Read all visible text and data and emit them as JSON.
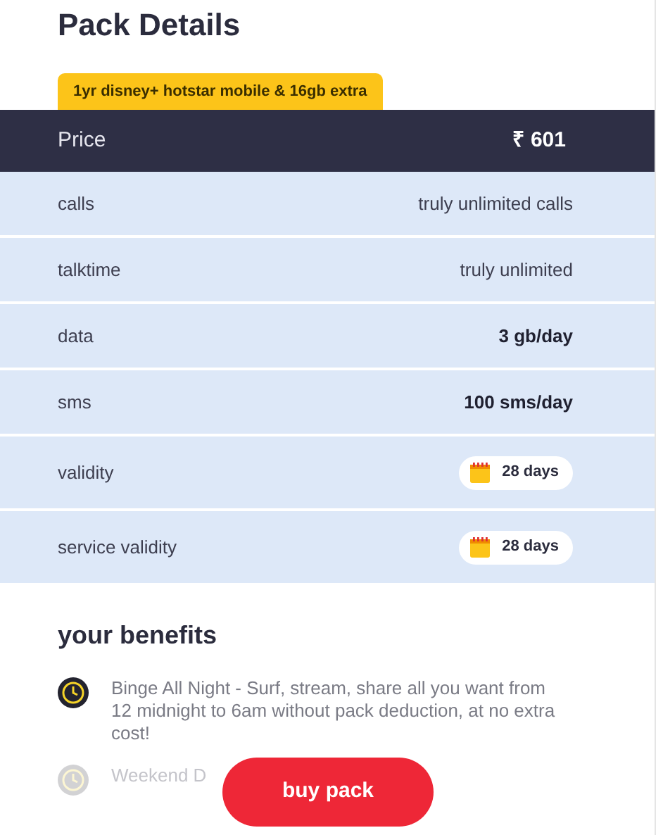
{
  "title": "Pack Details",
  "badge": "1yr disney+ hotstar mobile & 16gb extra",
  "price": {
    "label": "Price",
    "value": "₹ 601"
  },
  "rows": [
    {
      "label": "calls",
      "value": "truly unlimited calls",
      "kind": "text",
      "bold": false
    },
    {
      "label": "talktime",
      "value": "truly unlimited",
      "kind": "text",
      "bold": false
    },
    {
      "label": "data",
      "value": "3 gb/day",
      "kind": "text",
      "bold": true
    },
    {
      "label": "sms",
      "value": "100 sms/day",
      "kind": "text",
      "bold": true
    },
    {
      "label": "validity",
      "value": "28 days",
      "kind": "pill"
    },
    {
      "label": "service validity",
      "value": "28 days",
      "kind": "pill"
    }
  ],
  "benefits_title": "your benefits",
  "benefits": [
    {
      "text": "Binge All Night - Surf, stream, share all you want from 12 midnight to 6am without pack deduction, at no extra cost!",
      "faded": false
    },
    {
      "text": "Weekend D",
      "faded": true
    }
  ],
  "buy_button": "buy pack"
}
